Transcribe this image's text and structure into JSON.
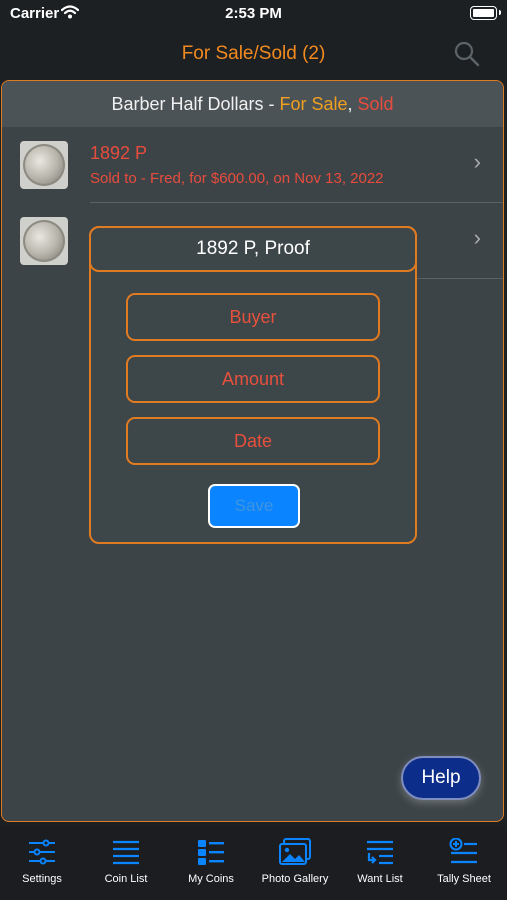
{
  "status_bar": {
    "carrier": "Carrier",
    "time": "2:53 PM"
  },
  "nav": {
    "title": "For Sale/Sold (2)"
  },
  "section": {
    "title": "Barber Half Dollars - ",
    "for_sale": "For Sale",
    "separator": ", ",
    "sold": "Sold"
  },
  "coins": [
    {
      "title": "1892 P",
      "subtitle": "Sold to - Fred, for $600.00, on Nov 13, 2022"
    },
    {
      "title": "",
      "subtitle": ""
    }
  ],
  "modal": {
    "title": "1892 P, Proof",
    "buyer_placeholder": "Buyer",
    "amount_placeholder": "Amount",
    "date_placeholder": "Date",
    "save_label": "Save"
  },
  "help": {
    "label": "Help"
  },
  "tab_bar": {
    "tabs": [
      {
        "label": "Settings",
        "icon": "sliders-icon"
      },
      {
        "label": "Coin List",
        "icon": "list-icon"
      },
      {
        "label": "My Coins",
        "icon": "grid-list-icon"
      },
      {
        "label": "Photo Gallery",
        "icon": "photos-icon"
      },
      {
        "label": "Want List",
        "icon": "want-list-icon"
      },
      {
        "label": "Tally Sheet",
        "icon": "tally-sheet-icon"
      }
    ]
  },
  "colors": {
    "accent": "#f28a1e",
    "sold": "#e84c3d",
    "for_sale": "#f0a020",
    "tab_icon": "#0a84ff"
  }
}
